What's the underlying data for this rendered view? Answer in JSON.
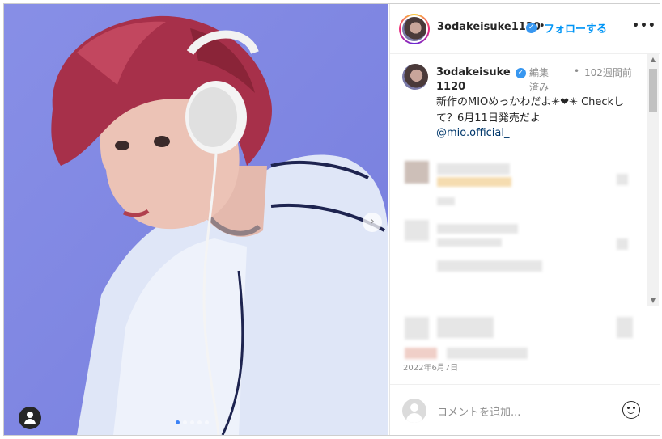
{
  "header": {
    "username": "3odakeisuke1120",
    "separator": "•",
    "follow_label": "フォローする",
    "more_label": "•••"
  },
  "caption": {
    "username": "3odakeisuke1120",
    "edited_label": "編集済み",
    "bullet": "•",
    "time_ago": "102週間前",
    "text": "新作のMIOめっかわだよ✳︎❤︎✳︎ Checkして？6月11日発売だよ",
    "mention": "@mio.official_"
  },
  "post_date": "2022年6月7日",
  "comment_box": {
    "placeholder": "コメントを追加..."
  },
  "photo": {
    "next_icon": "›",
    "carousel_active_index": 0,
    "carousel_count": 5
  },
  "scrollbar": {
    "up_arrow": "▲",
    "down_arrow": "▼"
  },
  "colors": {
    "background_blue": "#7c84e4",
    "hair": "#a7304a",
    "follow_blue": "#0095f6",
    "verified_blue": "#3897f0",
    "link": "#00376b"
  }
}
